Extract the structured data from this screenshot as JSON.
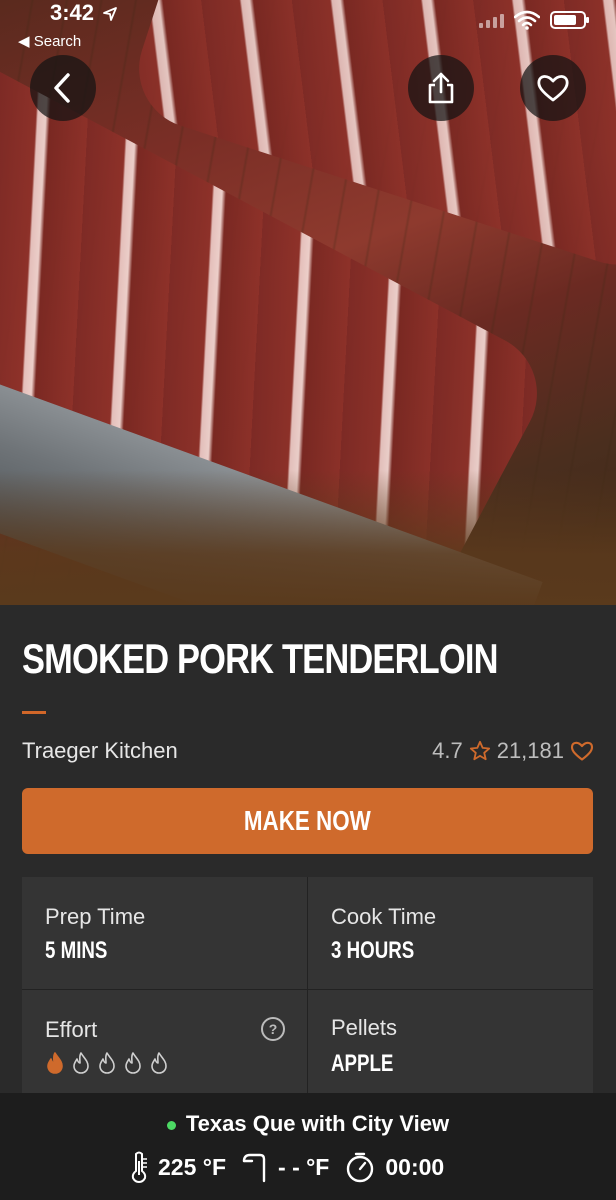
{
  "status_bar": {
    "time": "3:42",
    "back_app": "Search"
  },
  "hero": {
    "image_alt_icon": "recipe-photo"
  },
  "recipe": {
    "title": "SMOKED PORK TENDERLOIN",
    "author": "Traeger Kitchen",
    "rating": "4.7",
    "favorites": "21,181",
    "make_now_label": "MAKE NOW",
    "prep_time_label": "Prep Time",
    "prep_time_value": "5 MINS",
    "cook_time_label": "Cook Time",
    "cook_time_value": "3 HOURS",
    "effort_label": "Effort",
    "effort_level": 1,
    "effort_max": 5,
    "pellets_label": "Pellets",
    "pellets_value": "APPLE"
  },
  "grill": {
    "name": "Texas Que with City View",
    "temperature": "225 °F",
    "probe": "- - °F",
    "timer": "00:00",
    "connected_color": "#4cd964"
  },
  "colors": {
    "accent": "#cf6a2c",
    "background": "#2a2a2a",
    "panel": "#343434",
    "bottom_bar": "#1d1d1d"
  }
}
